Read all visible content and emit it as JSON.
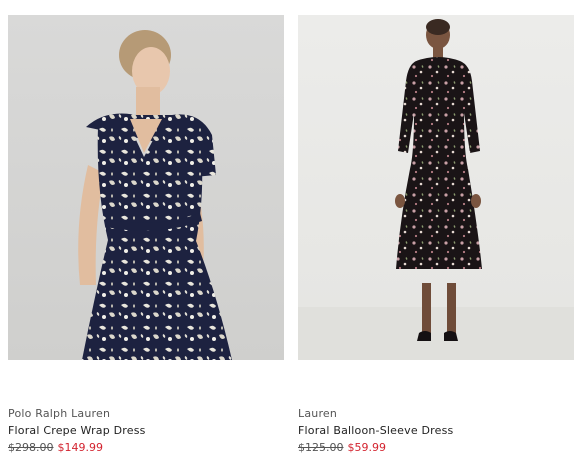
{
  "products": [
    {
      "brand": "Polo Ralph Lauren",
      "name": "Floral Crepe Wrap Dress",
      "original_price": "$298.00",
      "sale_price": "$149.99",
      "image_alt": "Model wearing navy floral crepe wrap dress"
    },
    {
      "brand": "Lauren",
      "name": "Floral Balloon-Sleeve Dress",
      "original_price": "$125.00",
      "sale_price": "$59.99",
      "image_alt": "Model wearing black floral balloon-sleeve midi dress"
    }
  ],
  "colors": {
    "brand_text": "#555555",
    "name_text": "#1f1f1f",
    "sale_price": "#d3232f",
    "dress_navy": "#1d2240",
    "dress_black": "#1a1416"
  }
}
